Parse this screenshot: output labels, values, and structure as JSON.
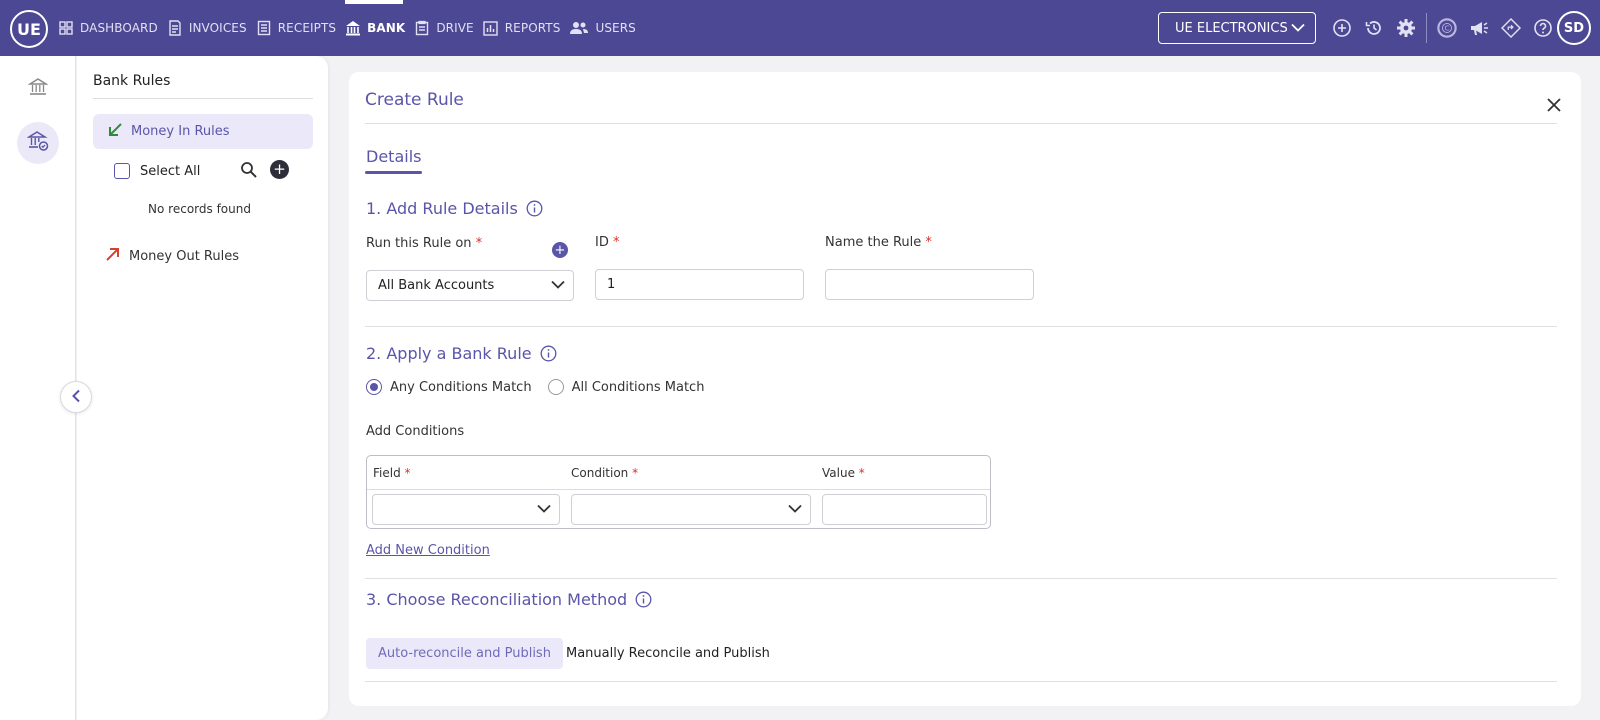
{
  "app": {
    "logo_text": "UE",
    "user_initials": "SD"
  },
  "nav": {
    "items": [
      {
        "label": "DASHBOARD",
        "icon": "dashboard-grid-icon"
      },
      {
        "label": "INVOICES",
        "icon": "invoice-icon"
      },
      {
        "label": "RECEIPTS",
        "icon": "receipt-icon"
      },
      {
        "label": "BANK",
        "icon": "bank-icon",
        "active": true
      },
      {
        "label": "DRIVE",
        "icon": "document-icon"
      },
      {
        "label": "REPORTS",
        "icon": "report-chart-icon"
      },
      {
        "label": "USERS",
        "icon": "users-icon"
      }
    ],
    "company": "UE ELECTRONICS",
    "icons": [
      "add-circle-icon",
      "history-icon",
      "gear-icon",
      "c-logo-icon",
      "megaphone-icon",
      "diamond-arrow-icon",
      "help-icon"
    ]
  },
  "rail": {
    "icons": [
      "bank-icon",
      "bank-rules-icon"
    ]
  },
  "rules_panel": {
    "title": "Bank Rules",
    "money_in": "Money In Rules",
    "select_all": "Select All",
    "empty": "No records found",
    "money_out": "Money Out Rules"
  },
  "form": {
    "title": "Create Rule",
    "tab": "Details",
    "section1": {
      "title": "1. Add Rule Details",
      "run_label": "Run this Rule on",
      "run_value": "All Bank Accounts",
      "id_label": "ID",
      "id_value": "1",
      "name_label": "Name the Rule",
      "name_value": "",
      "required_mark": "*"
    },
    "section2": {
      "title": "2. Apply a Bank Rule",
      "radio_any": "Any Conditions Match",
      "radio_all": "All Conditions Match",
      "selected": "any",
      "add_conditions": "Add Conditions",
      "col_field": "Field",
      "col_condition": "Condition",
      "col_value": "Value",
      "add_new": "Add New Condition"
    },
    "section3": {
      "title": "3. Choose Reconciliation Method",
      "option_auto": "Auto-reconcile and Publish",
      "option_manual": "Manually Reconcile and Publish",
      "selected": "auto"
    }
  },
  "colors": {
    "nav_bg": "#4d4894",
    "accent": "#5a55a8",
    "required": "#d93025",
    "money_in_arrow": "#2e8b3a",
    "money_out_arrow": "#d9412e"
  }
}
